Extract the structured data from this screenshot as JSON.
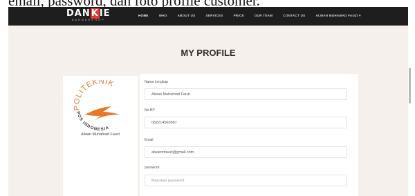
{
  "doc_text": "email, password, dan foto profile customer.",
  "brand": {
    "name_pre": "DAN",
    "name_k": "K",
    "name_post": "IE",
    "tagline": "BARBERSHOP"
  },
  "nav": {
    "items": [
      "HOME",
      "WHO",
      "ABOUT US",
      "SERVICES",
      "PRICE",
      "OUR TEAM",
      "CONTACT US",
      "ALWAN MUHAMAD FAUZI ▾"
    ]
  },
  "page": {
    "title": "MY PROFILE"
  },
  "profile": {
    "logo_text_top": "POLITEKNIK",
    "logo_text_bottom": "POS INDONESIA",
    "name": "Alwan Muhamad Fauzi"
  },
  "form": {
    "name_label": "Nama Lengkap",
    "name_value": "Alwan Muhamad Fauzi",
    "phone_label": "No.HP",
    "phone_value": "082214560987",
    "email_label": "Email",
    "email_value": "alwanmfauzi@gmail.com",
    "password_label": "password",
    "password_placeholder": "Masukan password"
  },
  "colors": {
    "accent": "#e53935",
    "navbar": "#1e1e1e",
    "background": "#f5f0eb",
    "logo_orange": "#e8772a"
  }
}
